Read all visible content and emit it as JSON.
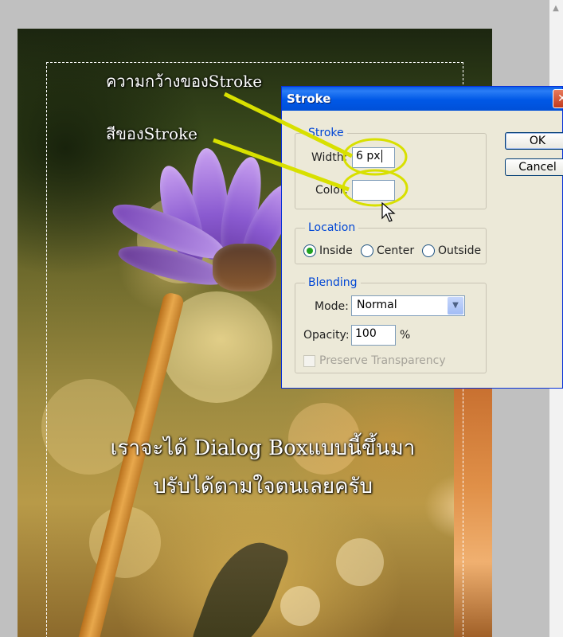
{
  "photo": {
    "annotation_width_label": "ความกว้างของStroke",
    "annotation_color_label": "สีของStroke",
    "caption_line1": "เราจะได้ Dialog Boxแบบนี้ขึ้นมา",
    "caption_line2": "ปรับได้ตามใจตนเลยครับ"
  },
  "dialog": {
    "title": "Stroke",
    "close_glyph": "✕",
    "ok_label": "OK",
    "cancel_label": "Cancel",
    "stroke_group": {
      "title": "Stroke",
      "width_label": "Width:",
      "width_value": "6 px",
      "color_label": "Color:"
    },
    "location_group": {
      "title": "Location",
      "options": [
        "Inside",
        "Center",
        "Outside"
      ],
      "selected": "Inside"
    },
    "blending_group": {
      "title": "Blending",
      "mode_label": "Mode:",
      "mode_value": "Normal",
      "opacity_label": "Opacity:",
      "opacity_value": "100",
      "opacity_unit": "%",
      "preserve_label": "Preserve Transparency",
      "preserve_checked": false
    }
  },
  "colors": {
    "title_bar": "#0058e6",
    "group_title": "#0046d5",
    "highlight_ring": "#d8e000",
    "stroke_color_swatch": "#ffffff"
  }
}
